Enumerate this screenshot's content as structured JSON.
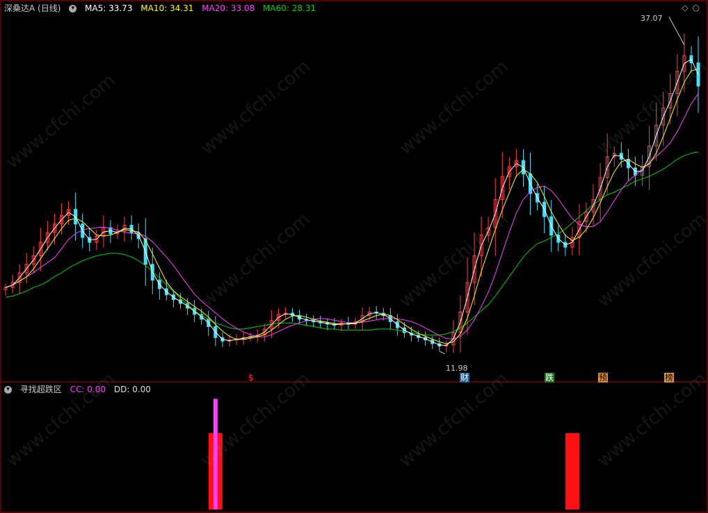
{
  "header": {
    "stock_title": "深桑达A (日线)",
    "ma5": "MA5: 33.73",
    "ma10": "MA10: 34.31",
    "ma20": "MA20: 33.08",
    "ma60": "MA60: 28.31"
  },
  "indicator": {
    "title": "寻找超跌区",
    "cc": "CC: 0.00",
    "dd": "DD: 0.00"
  },
  "labels": {
    "high": "37.07",
    "low": "11.98"
  },
  "markers": [
    {
      "text": "$",
      "color": "#ff3030",
      "bg": "transparent"
    },
    {
      "text": "财",
      "color": "#ffffff",
      "bg": "#1f5fa0"
    },
    {
      "text": "跌",
      "color": "#ffffff",
      "bg": "#1f7a1f"
    },
    {
      "text": "预",
      "color": "#000000",
      "bg": "#e09030"
    },
    {
      "text": "榜",
      "color": "#000000",
      "bg": "#e09030"
    }
  ],
  "watermark": "www.cfchi.com",
  "colors": {
    "ma5": "#ffffff",
    "ma10": "#ffff00",
    "ma20": "#ff40ff",
    "ma60": "#00d000",
    "up": "#ff4040",
    "down": "#40e0ff",
    "frame": "#b00000"
  },
  "chart_data": [
    {
      "type": "candlestick",
      "title": "深桑达A (日线)",
      "price_high": 37.07,
      "price_low": 11.98,
      "ylim": [
        10.5,
        39.5
      ],
      "close": [
        17.2,
        17.6,
        18.4,
        19.1,
        19.8,
        20.9,
        21.7,
        22.4,
        23.1,
        23.6,
        22.4,
        21.3,
        20.9,
        21.4,
        22.1,
        21.6,
        21.8,
        22.3,
        21.7,
        21.2,
        19.1,
        17.8,
        17.1,
        16.6,
        16.2,
        15.9,
        15.5,
        15.0,
        14.6,
        14.0,
        13.1,
        12.8,
        12.9,
        13.0,
        13.1,
        13.2,
        13.3,
        13.8,
        14.5,
        15.0,
        15.1,
        14.9,
        14.6,
        14.5,
        14.4,
        14.3,
        14.2,
        14.1,
        14.3,
        14.2,
        14.4,
        14.9,
        15.2,
        15.1,
        14.9,
        14.4,
        13.9,
        13.5,
        13.3,
        13.1,
        12.9,
        12.6,
        12.4,
        12.5,
        13.5,
        15.2,
        17.6,
        19.8,
        21.5,
        22.1,
        24.4,
        26.3,
        27.1,
        27.6,
        26.5,
        24.9,
        24.2,
        23.0,
        21.5,
        20.9,
        20.5,
        21.3,
        22.6,
        23.4,
        24.4,
        26.2,
        27.9,
        28.2,
        27.7,
        27.0,
        26.4,
        27.1,
        28.8,
        30.5,
        31.9,
        33.1,
        34.9,
        36.2,
        35.6,
        33.7
      ],
      "ma60": [
        16.4,
        16.5,
        16.7,
        16.9,
        17.2,
        17.4,
        17.7,
        18.1,
        18.4,
        18.8,
        19.1,
        19.4,
        19.6,
        19.8,
        19.9,
        20.0,
        20.0,
        19.9,
        19.7,
        19.4,
        19.0,
        18.5,
        18.0,
        17.4,
        16.9,
        16.3,
        15.8,
        15.3,
        14.9,
        14.6,
        14.3,
        14.1,
        13.9,
        13.8,
        13.8,
        13.9,
        14.0,
        14.1,
        14.2,
        14.3,
        14.3,
        14.3,
        14.2,
        14.1,
        14.0,
        13.9,
        13.8,
        13.8,
        13.7,
        13.7,
        13.7,
        13.7,
        13.7,
        13.8,
        13.8,
        13.8,
        13.7,
        13.6,
        13.5,
        13.4,
        13.3,
        13.3,
        13.3,
        13.4,
        13.6,
        13.9,
        14.3,
        14.8,
        15.3,
        15.8,
        16.5,
        17.3,
        18.1,
        18.9,
        19.7,
        20.3,
        20.8,
        21.0,
        21.3,
        21.6,
        22.0,
        22.5,
        23.0,
        23.5,
        24.0,
        24.4,
        24.8,
        25.0,
        25.3,
        25.6,
        25.9,
        26.1,
        26.3,
        26.6,
        26.9,
        27.3,
        27.7,
        28.0,
        28.2,
        28.31
      ]
    },
    {
      "type": "bar",
      "title": "寻找超跌区",
      "series": [
        {
          "name": "CC",
          "values": [
            {
              "index": 30,
              "value": 1.0
            },
            {
              "index": 81,
              "value": 1.0
            }
          ]
        },
        {
          "name": "DD",
          "values": [
            {
              "index": 30,
              "value": 1.45
            }
          ]
        }
      ]
    }
  ]
}
